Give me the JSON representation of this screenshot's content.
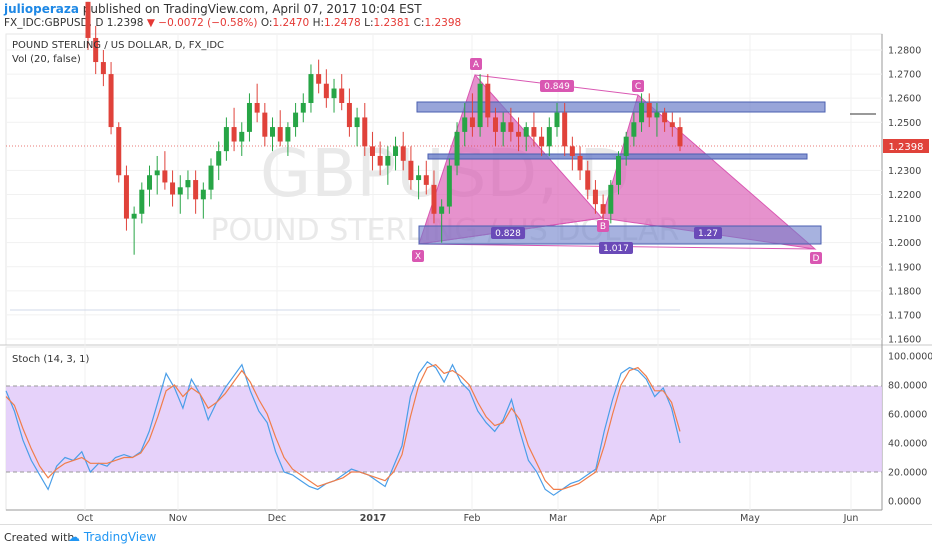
{
  "header": {
    "author": "julioperaza",
    "published": "published on TradingView.com, April 07, 2017 10:04 EST",
    "symbol": "FX_IDC:GBPUSD, D",
    "last": "1.2398",
    "change": "−0.0072 (−0.58%)",
    "o_label": "O:",
    "o": "1.2470",
    "h_label": "H:",
    "h": "1.2478",
    "l_label": "L:",
    "l": "1.2381",
    "c_label": "C:",
    "c": "1.2398"
  },
  "legend": {
    "title": "POUND STERLING / US DOLLAR, D, FX_IDC",
    "vol": "Vol (20, false)",
    "stoch": "Stoch (14, 3, 1)"
  },
  "watermark": {
    "symbol": "GBPUSD, D",
    "name": "POUND STERLING / US DOLLAR"
  },
  "footer": {
    "created": "Created with",
    "brand": "TradingView"
  },
  "colors": {
    "up": "#27a546",
    "down": "#e0423a",
    "pattern": "#d957b2",
    "zone": "#6c7fc9",
    "stochBand": "#e3cdfa",
    "kLine": "#4a9ee8",
    "dLine": "#f07d4a"
  },
  "chart_data": [
    {
      "type": "candlestick",
      "title": "POUND STERLING / US DOLLAR, D, FX_IDC",
      "ylim": [
        1.155,
        1.285
      ],
      "yticks": [
        "1.2800",
        "1.2700",
        "1.2600",
        "1.2500",
        "1.2398",
        "1.2300",
        "1.2200",
        "1.2100",
        "1.2000",
        "1.1900",
        "1.1800",
        "1.1700",
        "1.1600"
      ],
      "x_labels": [
        "Oct",
        "Nov",
        "Dec",
        "2017",
        "Feb",
        "Mar",
        "Apr",
        "May",
        "Jun"
      ],
      "last_price": "1.2398",
      "candles": [
        [
          1.3,
          1.3,
          1.28,
          1.285
        ],
        [
          1.285,
          1.29,
          1.27,
          1.275
        ],
        [
          1.275,
          1.28,
          1.265,
          1.27
        ],
        [
          1.27,
          1.275,
          1.245,
          1.248
        ],
        [
          1.248,
          1.25,
          1.225,
          1.228
        ],
        [
          1.228,
          1.232,
          1.205,
          1.21
        ],
        [
          1.21,
          1.215,
          1.195,
          1.212
        ],
        [
          1.212,
          1.225,
          1.208,
          1.222
        ],
        [
          1.222,
          1.232,
          1.215,
          1.228
        ],
        [
          1.228,
          1.236,
          1.22,
          1.23
        ],
        [
          1.23,
          1.238,
          1.222,
          1.225
        ],
        [
          1.225,
          1.23,
          1.215,
          1.22
        ],
        [
          1.22,
          1.228,
          1.212,
          1.223
        ],
        [
          1.223,
          1.23,
          1.218,
          1.226
        ],
        [
          1.226,
          1.23,
          1.212,
          1.218
        ],
        [
          1.218,
          1.225,
          1.21,
          1.222
        ],
        [
          1.222,
          1.235,
          1.218,
          1.232
        ],
        [
          1.232,
          1.242,
          1.226,
          1.238
        ],
        [
          1.238,
          1.252,
          1.234,
          1.248
        ],
        [
          1.248,
          1.256,
          1.238,
          1.242
        ],
        [
          1.242,
          1.25,
          1.236,
          1.246
        ],
        [
          1.246,
          1.262,
          1.242,
          1.258
        ],
        [
          1.258,
          1.266,
          1.25,
          1.254
        ],
        [
          1.254,
          1.258,
          1.24,
          1.244
        ],
        [
          1.244,
          1.252,
          1.238,
          1.248
        ],
        [
          1.248,
          1.255,
          1.24,
          1.242
        ],
        [
          1.242,
          1.25,
          1.236,
          1.248
        ],
        [
          1.248,
          1.258,
          1.244,
          1.254
        ],
        [
          1.254,
          1.262,
          1.25,
          1.258
        ],
        [
          1.258,
          1.274,
          1.254,
          1.27
        ],
        [
          1.27,
          1.276,
          1.262,
          1.266
        ],
        [
          1.266,
          1.272,
          1.256,
          1.26
        ],
        [
          1.26,
          1.268,
          1.254,
          1.264
        ],
        [
          1.264,
          1.27,
          1.255,
          1.258
        ],
        [
          1.258,
          1.264,
          1.244,
          1.248
        ],
        [
          1.248,
          1.256,
          1.24,
          1.252
        ],
        [
          1.252,
          1.258,
          1.236,
          1.24
        ],
        [
          1.24,
          1.246,
          1.23,
          1.236
        ],
        [
          1.236,
          1.242,
          1.228,
          1.232
        ],
        [
          1.232,
          1.24,
          1.224,
          1.236
        ],
        [
          1.236,
          1.244,
          1.23,
          1.24
        ],
        [
          1.24,
          1.246,
          1.23,
          1.234
        ],
        [
          1.234,
          1.24,
          1.222,
          1.226
        ],
        [
          1.226,
          1.232,
          1.218,
          1.228
        ],
        [
          1.228,
          1.234,
          1.22,
          1.224
        ],
        [
          1.224,
          1.23,
          1.208,
          1.212
        ],
        [
          1.212,
          1.218,
          1.2,
          1.215
        ],
        [
          1.215,
          1.235,
          1.212,
          1.232
        ],
        [
          1.232,
          1.25,
          1.228,
          1.246
        ],
        [
          1.246,
          1.258,
          1.24,
          1.252
        ],
        [
          1.252,
          1.262,
          1.244,
          1.248
        ],
        [
          1.248,
          1.27,
          1.244,
          1.266
        ],
        [
          1.266,
          1.27,
          1.248,
          1.252
        ],
        [
          1.252,
          1.256,
          1.24,
          1.246
        ],
        [
          1.246,
          1.254,
          1.24,
          1.25
        ],
        [
          1.25,
          1.256,
          1.242,
          1.246
        ],
        [
          1.246,
          1.252,
          1.238,
          1.244
        ],
        [
          1.244,
          1.25,
          1.238,
          1.248
        ],
        [
          1.248,
          1.254,
          1.24,
          1.244
        ],
        [
          1.244,
          1.248,
          1.236,
          1.24
        ],
        [
          1.24,
          1.252,
          1.236,
          1.248
        ],
        [
          1.248,
          1.258,
          1.244,
          1.254
        ],
        [
          1.254,
          1.258,
          1.236,
          1.24
        ],
        [
          1.24,
          1.244,
          1.23,
          1.236
        ],
        [
          1.236,
          1.24,
          1.226,
          1.23
        ],
        [
          1.23,
          1.234,
          1.218,
          1.222
        ],
        [
          1.222,
          1.226,
          1.212,
          1.216
        ],
        [
          1.216,
          1.22,
          1.208,
          1.212
        ],
        [
          1.212,
          1.226,
          1.208,
          1.224
        ],
        [
          1.224,
          1.238,
          1.22,
          1.236
        ],
        [
          1.236,
          1.246,
          1.232,
          1.244
        ],
        [
          1.244,
          1.254,
          1.24,
          1.25
        ],
        [
          1.25,
          1.262,
          1.246,
          1.258
        ],
        [
          1.258,
          1.262,
          1.248,
          1.252
        ],
        [
          1.252,
          1.258,
          1.244,
          1.254
        ],
        [
          1.254,
          1.256,
          1.246,
          1.25
        ],
        [
          1.25,
          1.254,
          1.244,
          1.248
        ],
        [
          1.248,
          1.252,
          1.238,
          1.24
        ]
      ],
      "annotations": {
        "points": {
          "X": "X",
          "A": "A",
          "B": "B",
          "C": "C",
          "D": "D"
        },
        "ratios": {
          "xb": "0.828",
          "ac": "0.849",
          "bd": "1.27",
          "xd": "1.017"
        }
      }
    },
    {
      "type": "line",
      "title": "Stoch (14, 3, 1)",
      "ylim": [
        -10,
        105
      ],
      "yticks": [
        "100.0000",
        "80.0000",
        "60.0000",
        "40.0000",
        "20.0000",
        "0.0000"
      ],
      "band": [
        20,
        80
      ],
      "series": [
        {
          "name": "%K",
          "values": [
            76,
            62,
            42,
            28,
            18,
            8,
            24,
            30,
            28,
            34,
            20,
            26,
            24,
            30,
            32,
            30,
            34,
            48,
            68,
            88,
            78,
            64,
            84,
            74,
            56,
            68,
            78,
            86,
            94,
            76,
            62,
            54,
            34,
            20,
            18,
            14,
            10,
            8,
            12,
            14,
            18,
            22,
            20,
            18,
            14,
            10,
            24,
            38,
            72,
            88,
            96,
            92,
            82,
            94,
            82,
            76,
            62,
            54,
            48,
            56,
            70,
            48,
            28,
            20,
            8,
            4,
            8,
            12,
            14,
            18,
            22,
            48,
            70,
            88,
            92,
            90,
            84,
            72,
            78,
            64,
            40
          ]
        },
        {
          "name": "%D",
          "values": [
            72,
            66,
            50,
            36,
            24,
            16,
            22,
            26,
            28,
            30,
            26,
            26,
            26,
            28,
            30,
            30,
            33,
            42,
            58,
            76,
            80,
            72,
            78,
            74,
            64,
            68,
            74,
            82,
            90,
            82,
            70,
            60,
            44,
            30,
            22,
            18,
            14,
            10,
            12,
            14,
            16,
            20,
            20,
            18,
            16,
            14,
            20,
            32,
            58,
            80,
            92,
            94,
            88,
            90,
            86,
            80,
            68,
            58,
            52,
            54,
            64,
            56,
            38,
            26,
            14,
            8,
            8,
            10,
            12,
            16,
            20,
            38,
            60,
            80,
            90,
            92,
            86,
            76,
            76,
            68,
            48
          ]
        }
      ]
    }
  ]
}
